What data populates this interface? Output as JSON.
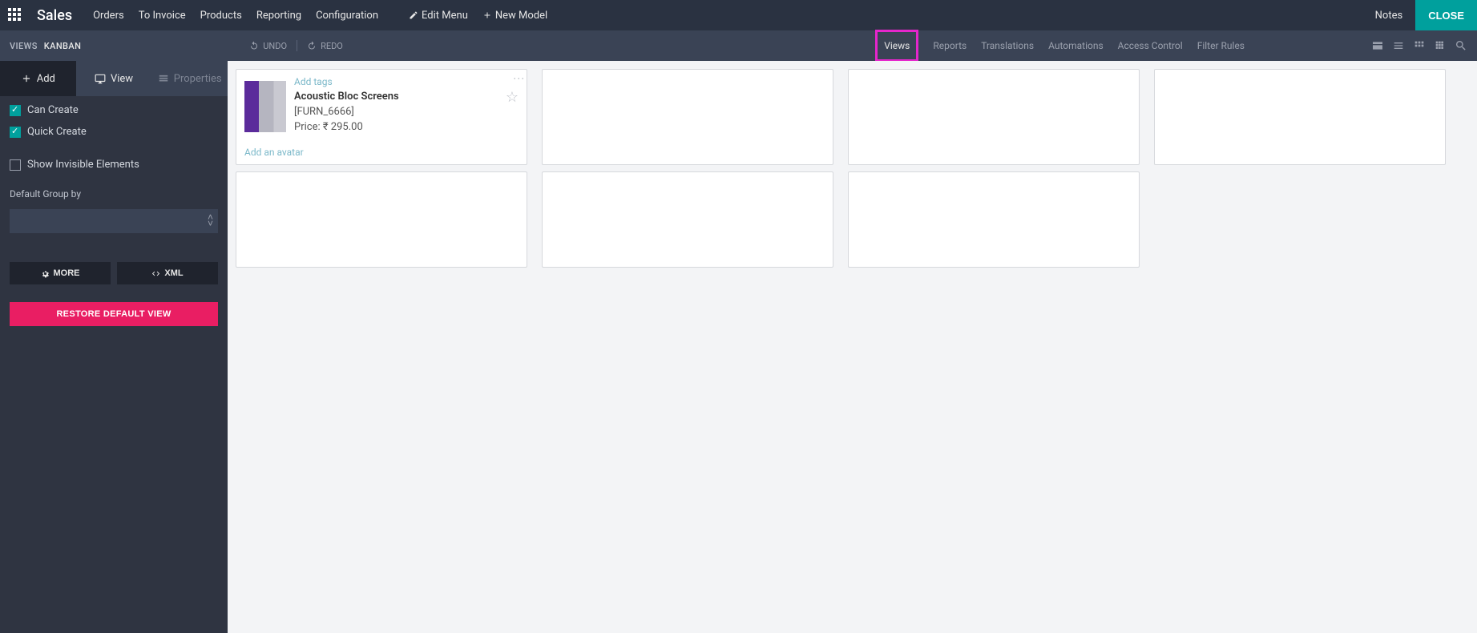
{
  "topbar": {
    "brand": "Sales",
    "menu": [
      "Orders",
      "To Invoice",
      "Products",
      "Reporting",
      "Configuration"
    ],
    "edit_menu": "Edit Menu",
    "new_model": "New Model",
    "notes": "Notes",
    "close": "CLOSE"
  },
  "toolbar": {
    "breadcrumb": [
      "VIEWS",
      "KANBAN"
    ],
    "undo": "UNDO",
    "redo": "REDO",
    "tabs": [
      "Views",
      "Reports",
      "Translations",
      "Automations",
      "Access Control",
      "Filter Rules"
    ]
  },
  "sidebar": {
    "tabs": {
      "add": "Add",
      "view": "View",
      "properties": "Properties"
    },
    "can_create": "Can Create",
    "quick_create": "Quick Create",
    "show_invisible": "Show Invisible Elements",
    "default_group_by": "Default Group by",
    "more": "MORE",
    "xml": "XML",
    "restore": "RESTORE DEFAULT VIEW"
  },
  "card": {
    "add_tags": "Add tags",
    "title": "Acoustic Bloc Screens",
    "sku": "[FURN_6666]",
    "price_label": "Price:",
    "price_value": "₹ 295.00",
    "add_avatar": "Add an avatar"
  }
}
